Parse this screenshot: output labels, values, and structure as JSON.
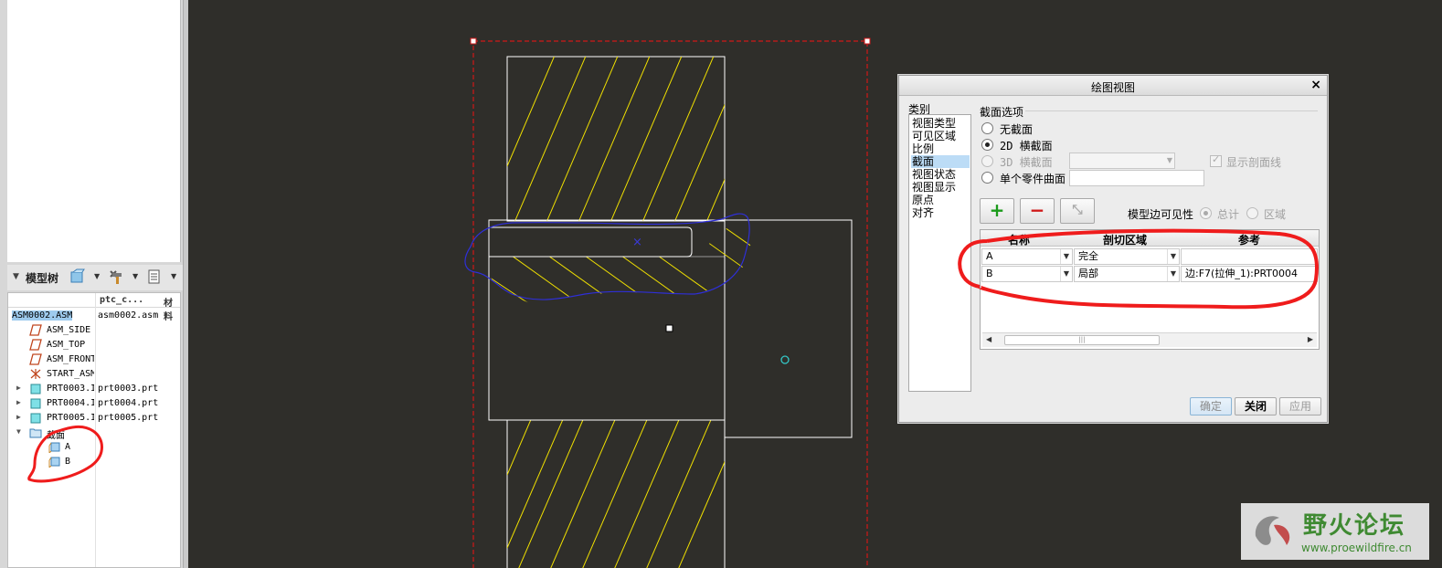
{
  "model_tree": {
    "title": "模型树",
    "columns": [
      "ptc_c...",
      "材料"
    ],
    "root": {
      "name": "ASM0002.ASM",
      "file": "asm0002.asm"
    },
    "items": [
      {
        "name": "ASM_SIDE",
        "file": "",
        "icon": "datum-plane-icon",
        "expandable": false
      },
      {
        "name": "ASM_TOP",
        "file": "",
        "icon": "datum-plane-icon",
        "expandable": false
      },
      {
        "name": "ASM_FRONT",
        "file": "",
        "icon": "datum-plane-icon",
        "expandable": false
      },
      {
        "name": "START_ASM",
        "file": "",
        "icon": "csys-icon",
        "expandable": false
      },
      {
        "name": "PRT0003.I",
        "file": "prt0003.prt",
        "icon": "part-icon",
        "expandable": true
      },
      {
        "name": "PRT0004.I",
        "file": "prt0004.prt",
        "icon": "part-icon",
        "expandable": true
      },
      {
        "name": "PRT0005.I",
        "file": "prt0005.prt",
        "icon": "part-icon",
        "expandable": true
      },
      {
        "name": "截面",
        "file": "",
        "icon": "section-folder-icon",
        "expandable": true
      }
    ],
    "sections": [
      "A",
      "B"
    ]
  },
  "dialog": {
    "title": "绘图视图",
    "category_label": "类别",
    "categories": [
      "视图类型",
      "可见区域",
      "比例",
      "截面",
      "视图状态",
      "视图显示",
      "原点",
      "对齐"
    ],
    "selected_category": "截面",
    "section_options_label": "截面选项",
    "opt_none": "无截面",
    "opt_2d": "2D 横截面",
    "opt_3d": "3D 横截面",
    "opt_surface": "单个零件曲面",
    "show_hatch": "显示剖面线",
    "edge_visibility_label": "模型边可见性",
    "vis_total": "总计",
    "vis_area": "区域",
    "table_headers": [
      "名称",
      "剖切区域",
      "参考"
    ],
    "rows": [
      {
        "name": "A",
        "region": "完全",
        "ref": ""
      },
      {
        "name": "B",
        "region": "局部",
        "ref": "边:F7(拉伸_1):PRT0004"
      }
    ],
    "buttons": {
      "ok": "确定",
      "close": "关闭",
      "apply": "应用"
    }
  },
  "watermark": {
    "title": "野火论坛",
    "url": "www.proewildfire.cn"
  },
  "colors": {
    "background": "#2f2e2a",
    "hatch": "#f0e000",
    "annotation_red": "#ef1c1c",
    "sketch_blue": "#2f2fd8",
    "frame_red": "#d01818",
    "point_cyan": "#34c7c7"
  }
}
